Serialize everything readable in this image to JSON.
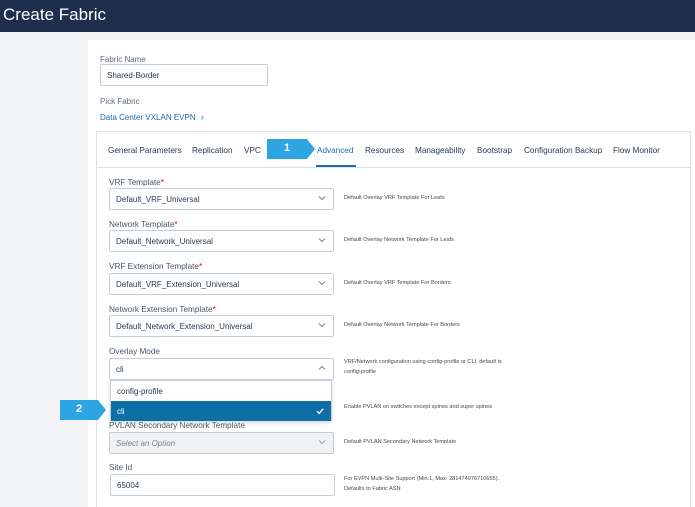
{
  "window": {
    "title": "Create Fabric"
  },
  "fabric_name": {
    "label": "Fabric Name",
    "value": "Shared-Border"
  },
  "pick_fabric": {
    "label": "Pick Fabric",
    "value": "Data Center VXLAN EVPN"
  },
  "tabs": [
    {
      "label": "General Parameters"
    },
    {
      "label": "Replication"
    },
    {
      "label": "VPC"
    },
    {
      "label": "Advanced",
      "active": true
    },
    {
      "label": "Resources"
    },
    {
      "label": "Manageability"
    },
    {
      "label": "Bootstrap"
    },
    {
      "label": "Configuration Backup"
    },
    {
      "label": "Flow Monitor"
    }
  ],
  "fields": {
    "vrf_template": {
      "label": "VRF Template",
      "required": "*",
      "value": "Default_VRF_Universal",
      "help": "Default Overlay VRF Template For Leafs"
    },
    "network_template": {
      "label": "Network Template",
      "required": "*",
      "value": "Default_Network_Universal",
      "help": "Default Overlay Network Template For Leafs"
    },
    "vrf_extension_template": {
      "label": "VRF Extension Template",
      "required": "*",
      "value": "Default_VRF_Extension_Universal",
      "help": "Default Overlay VRF Template For Borders"
    },
    "network_extension_template": {
      "label": "Network Extension Template",
      "required": "*",
      "value": "Default_Network_Extension_Universal",
      "help": "Default Overlay Network Template For Borders"
    },
    "overlay_mode": {
      "label": "Overlay Mode",
      "value": "cli",
      "help_line1": "VRF/Network configuration using config-profile or CLI, default is",
      "help_line2": "config-profile",
      "options": [
        "config-profile",
        "cli"
      ]
    },
    "pvlan_help": "Enable PVLAN on switches except spines and super spines",
    "pvlan_secondary": {
      "label": "PVLAN Secondary Network Template",
      "placeholder": "Select an Option",
      "help": "Default PVLAN Secondary Network Template"
    },
    "site_id": {
      "label": "Site Id",
      "value": "65004",
      "help_line1": "For EVPN Multi-Site Support (Min:1, Max: 281474976710655).",
      "help_line2": "Defaults to Fabric ASN"
    }
  },
  "callouts": {
    "one": "1",
    "two": "2"
  },
  "colors": {
    "header": "#1d2f4c",
    "accent": "#1a6cae",
    "callout": "#2da5e3",
    "selected_option": "#0d6fa5"
  },
  "icons": {
    "select_arrow": "chevron-down-icon",
    "expanded_arrow": "chevron-up-icon",
    "selected": "check-icon",
    "link": "chevron-right-icon"
  }
}
